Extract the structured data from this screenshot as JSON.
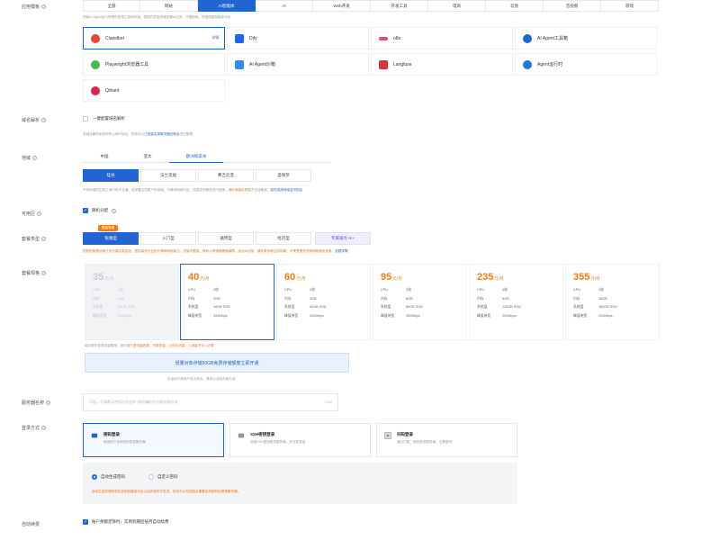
{
  "app_template": {
    "label": "应用模板",
    "tabs": [
      "全部",
      "网站",
      "AI智能体",
      "AI",
      "Web开发",
      "开发工具",
      "电商",
      "云盘",
      "音视频",
      "游戏"
    ],
    "active_tab": 2,
    "hint": "预装AI Agent运行所需的常用工具和环境，帮助开发者快速部署AI应用，开箱即用，快速搭建智能体业务",
    "apps": [
      {
        "name": "Clawdbot",
        "tag": "详情",
        "icon": "lobster-icon",
        "color": "#e8482e",
        "active": true
      },
      {
        "name": "Dify",
        "tag": "",
        "icon": "dify-icon",
        "color": "#1c64f2",
        "active": false
      },
      {
        "name": "n8n",
        "tag": "",
        "icon": "n8n-icon",
        "color": "#ea4b71",
        "active": false
      },
      {
        "name": "AI Agent工具箱",
        "tag": "",
        "icon": "agent-toolbox-icon",
        "color": "#2065d1",
        "active": false
      },
      {
        "name": "Playwright浏览器工具",
        "tag": "",
        "icon": "playwright-icon",
        "color": "#45ba4b",
        "active": false
      },
      {
        "name": "AI Agent沙箱",
        "tag": "",
        "icon": "sandbox-icon",
        "color": "#2d8cf0",
        "active": false
      },
      {
        "name": "Langfuse",
        "tag": "",
        "icon": "langfuse-icon",
        "color": "#d9333f",
        "active": false
      },
      {
        "name": "Agent运行时",
        "tag": "",
        "icon": "agent-runtime-icon",
        "color": "#1f7ae0",
        "active": false
      },
      {
        "name": "Qdrant",
        "tag": "",
        "icon": "qdrant-icon",
        "color": "#dc244c",
        "active": false
      }
    ]
  },
  "domain": {
    "label": "域名解析",
    "checkbox_label": "一键配置域名解析",
    "hint_prefix": "将域名解析到实例的公网IP地址，您将可以在",
    "hint_link": "轻量应用服务器控制台",
    "hint_suffix": "进行管理。"
  },
  "region": {
    "label": "地域",
    "tabs": [
      "中国",
      "亚太",
      "欧洲和美洲"
    ],
    "active_tab": 2,
    "zones": [
      "硅谷",
      "法兰克福",
      "弗吉尼亚",
      "圣保罗"
    ],
    "active_zone": 0,
    "hint_prefix": "不同地域的实例之间内网不互通，选择靠近您客户的地域，可降低网络时延，提高您的服务访问速度。",
    "hint_warn": "海外地域实例",
    "hint_middle": "暂不支持备案，",
    "hint_link": "如何选择地域及可用区"
  },
  "availability_zone": {
    "label": "可用区",
    "checkbox_label": "随机分配",
    "checked": true
  },
  "package_type": {
    "label": "套餐类型",
    "tabs": [
      "锐驰型",
      "入门型",
      "通用型",
      "经济型",
      "专属服务 Hi+"
    ],
    "active_tab": 0,
    "badge": "限量特惠",
    "warn": "锐驰型套餐适用于运行高负载应用，提供高性价比的计算和网络能力，流量不限量，具有公网带宽峰值保障，适合AI应用、建站等多种业务场景，可享受更多的网络和服务优惠。",
    "link": "查看详情"
  },
  "package_spec": {
    "label": "套餐规格",
    "plans": [
      {
        "price": "35",
        "unit": "元/月",
        "cpu": "1核",
        "mem": "1GB",
        "disk": "20GB SSD",
        "bw": "200Mbps",
        "state": "disabled"
      },
      {
        "price": "40",
        "unit": "元/月",
        "cpu": "2核",
        "mem": "2GB",
        "disk": "40GB SSD",
        "bw": "200Mbps",
        "state": "active"
      },
      {
        "price": "60",
        "unit": "元/月",
        "cpu": "2核",
        "mem": "4GB",
        "disk": "60GB SSD",
        "bw": "200Mbps",
        "state": "normal"
      },
      {
        "price": "95",
        "unit": "元/月",
        "cpu": "2核",
        "mem": "8GB",
        "disk": "80GB SSD",
        "bw": "200Mbps",
        "state": "normal"
      },
      {
        "price": "235",
        "unit": "元/月",
        "cpu": "4核",
        "mem": "8GB",
        "disk": "120GB SSD",
        "bw": "200Mbps",
        "state": "normal"
      },
      {
        "price": "355",
        "unit": "元/月",
        "cpu": "4核",
        "mem": "16GB",
        "disk": "180GB SSD",
        "bw": "200Mbps",
        "state": "normal"
      }
    ],
    "spec_labels": {
      "cpu": "CPU",
      "mem": "内存",
      "disk": "系统盘",
      "bw": "峰值带宽"
    },
    "note_prefix": "每月提供免费流量额度，超出部分",
    "note_warn": "按流量收费，不限流量，公网出流量，入流量不计入计费",
    "banner": "轻量对象存储50GB免费存储额度立即开通",
    "banner_hint": "仅适用于新用户首次购买，具体以活动页面为准"
  },
  "server_name": {
    "label": "服务器名称",
    "placeholder": "可选，不填默认使用应用名称+随机编码作为服务器名称",
    "counter": "0/60"
  },
  "login": {
    "label": "登录方式",
    "methods": [
      {
        "title": "密码登录",
        "desc": "使用用户名和密码登录服务器",
        "icon": "key-icon",
        "active": true
      },
      {
        "title": "SSH密钥登录",
        "desc": "使用SSH密钥登录服务器，安全性更高",
        "icon": "ssh-key-icon",
        "active": false
      },
      {
        "title": "扫码登录",
        "desc": "通过扫描二维码登录服务器，无需密码",
        "icon": "qrcode-icon",
        "active": false
      }
    ],
    "radio_auto": "自动生成密码",
    "radio_custom": "自定义密码",
    "warn": "自动生成的密码将在实例创建成功后以站内信形式发送，您也可以在控制台重置实例密码后登录服务器。"
  },
  "auto_renew": {
    "label": "自动续费",
    "checkbox_label": "账户余额足够时，实例到期后按月自动续费",
    "checked": true
  }
}
